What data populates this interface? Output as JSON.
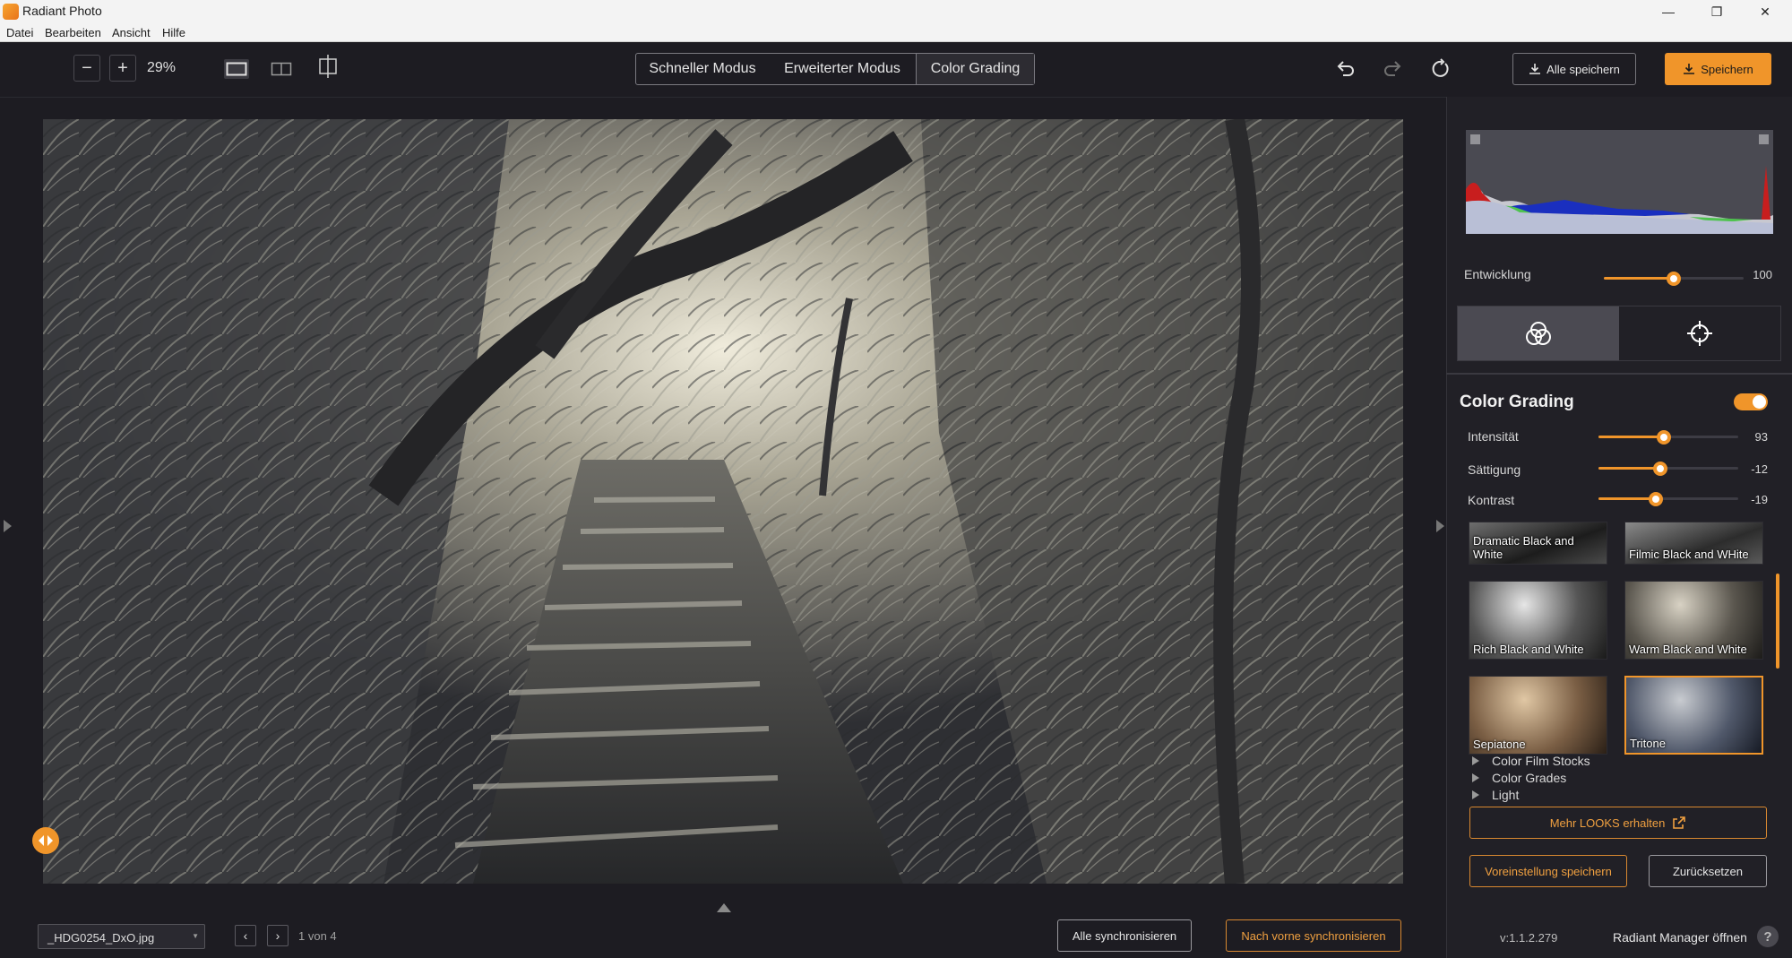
{
  "window": {
    "title": "Radiant Photo",
    "minimize": "—",
    "maximize": "❐",
    "close": "✕"
  },
  "menu": [
    "Datei",
    "Bearbeiten",
    "Ansicht",
    "Hilfe"
  ],
  "toolbar": {
    "zoom_out": "−",
    "zoom_in": "+",
    "zoom_value": "29%",
    "modes": [
      "Schneller Modus",
      "Erweiterter Modus",
      "Color Grading"
    ],
    "active_mode": "Color Grading",
    "save_all": "Alle speichern",
    "save": "Speichern"
  },
  "bottom": {
    "file_name": "_HDG0254_DxO.jpg",
    "page_count": "1 von 4",
    "sync_all": "Alle synchronisieren",
    "sync_forward": "Nach vorne synchronisieren"
  },
  "panel": {
    "development": {
      "label": "Entwicklung",
      "value": "100",
      "fraction": 0.5
    },
    "section_title": "Color Grading",
    "enabled": true,
    "sliders": [
      {
        "label": "Intensität",
        "value": "93",
        "fraction": 0.47
      },
      {
        "label": "Sättigung",
        "value": "-12",
        "fraction": 0.44
      },
      {
        "label": "Kontrast",
        "value": "-19",
        "fraction": 0.41
      }
    ],
    "looks": [
      {
        "label": "Dramatic Black and White",
        "selected": false
      },
      {
        "label": "Filmic Black and WHite",
        "selected": false
      },
      {
        "label": "Rich Black and White",
        "selected": false
      },
      {
        "label": "Warm Black and White",
        "selected": false
      },
      {
        "label": "Sepiatone",
        "selected": false
      },
      {
        "label": "Tritone",
        "selected": true
      }
    ],
    "categories": [
      "Color Film Stocks",
      "Color Grades",
      "Light"
    ],
    "more_looks": "Mehr LOOKS erhalten",
    "save_preset": "Voreinstellung speichern",
    "reset": "Zurücksetzen",
    "version": "v:1.1.2.279",
    "manager": "Radiant Manager öffnen",
    "help": "?"
  },
  "colors": {
    "accent": "#f0952a",
    "background": "#1d1c22",
    "panel": "#212026"
  }
}
